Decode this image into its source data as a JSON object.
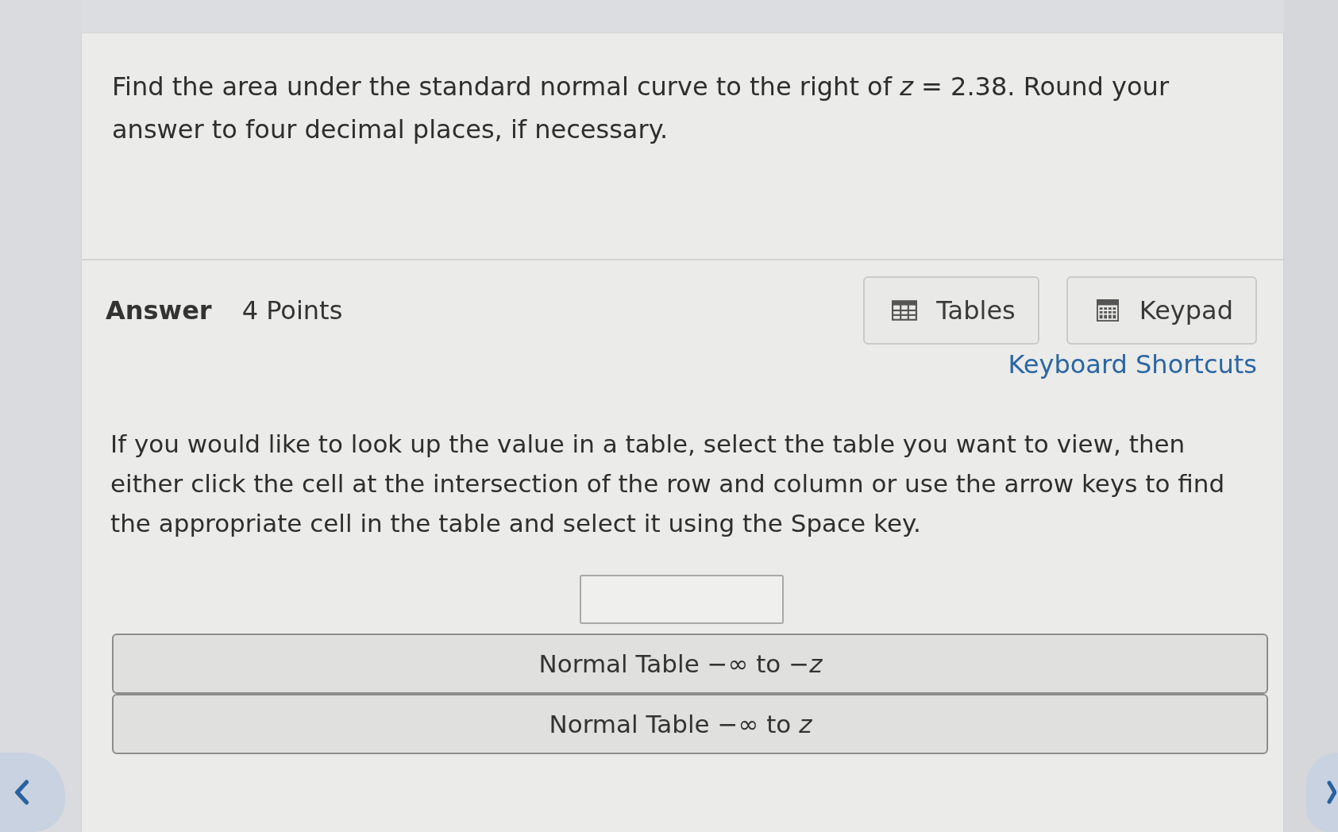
{
  "question": "Find the area under the standard normal curve to the right of *z* = 2.38. Round your answer to four decimal places, if necessary.",
  "answer": {
    "label": "Answer",
    "points": "4 Points"
  },
  "tools": [
    {
      "kind": "tables",
      "label": "Tables"
    },
    {
      "kind": "keypad",
      "label": "Keypad"
    }
  ],
  "shortcuts_link": "Keyboard Shortcuts",
  "instructions": "If you would like to look up the value in a table, select the table you want to view, then either click the cell at the intersection of the row and column or use the arrow keys to find the appropriate cell in the table and select it using the Space key.",
  "normal_tables": [
    {
      "label": "Normal Table −∞ to −*z*"
    },
    {
      "label": "Normal Table −∞ to *z*"
    }
  ]
}
